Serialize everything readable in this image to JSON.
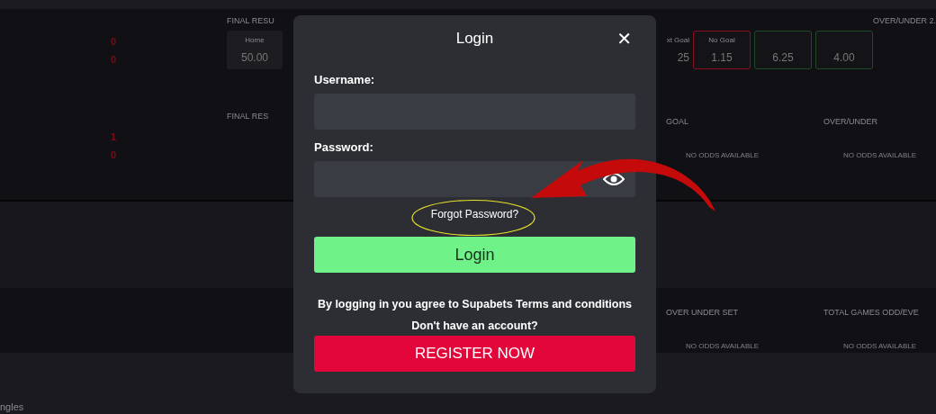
{
  "background": {
    "row_1": {
      "scores": [
        "0",
        "0"
      ],
      "header": "FINAL RESU",
      "odds_card": {
        "label": "Home",
        "value": "50.00"
      },
      "goal_stub": {
        "label": "xt Goal",
        "value": "25"
      },
      "goal_cards": [
        {
          "label": "No Goal",
          "value": "1.15",
          "color": "#8a1020"
        },
        {
          "value": "6.25",
          "color": "#1f4a28"
        },
        {
          "value": "4.00",
          "color": "#1f4a28"
        }
      ],
      "right_header": "OVER/UNDER 2."
    },
    "row_2": {
      "scores": [
        "1",
        "0"
      ],
      "header": "FINAL RES",
      "markets": [
        {
          "title": "GOAL",
          "note": "NO ODDS AVAILABLE"
        },
        {
          "title": "OVER/UNDER",
          "note": "NO ODDS AVAILABLE"
        }
      ]
    },
    "row_3": {
      "markets": [
        {
          "title": "OVER UNDER SET",
          "note": "NO ODDS AVAILABLE"
        },
        {
          "title": "TOTAL GAMES ODD/EVE",
          "note": "NO ODDS AVAILABLE"
        }
      ]
    },
    "footer": "ngles"
  },
  "modal": {
    "title": "Login",
    "close": "✕",
    "fields": [
      {
        "label": "Username:",
        "kind": "text"
      },
      {
        "label": "Password:",
        "kind": "password"
      }
    ],
    "forgot_link": "Forgot Password?",
    "login_button": "Login",
    "agreement": "By logging in you agree to Supabets Terms and conditions",
    "signup_prompt": "Don't have an account?",
    "register_button": "REGISTER NOW"
  }
}
